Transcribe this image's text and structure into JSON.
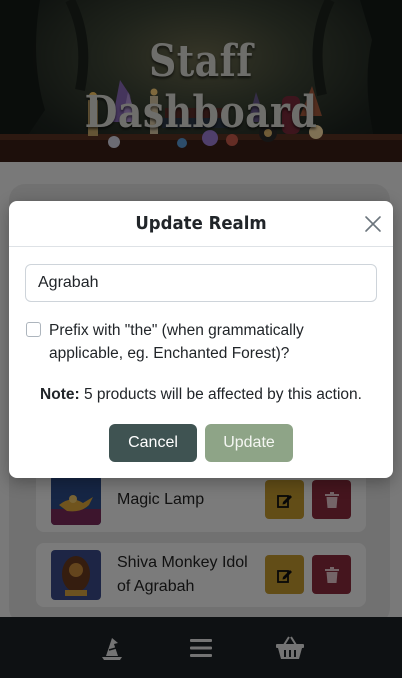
{
  "header": {
    "title": "Staff Dashboard"
  },
  "products": [
    {
      "name": "Magic Lamp",
      "thumb_icon": "magic-lamp-image"
    },
    {
      "name": "Shiva Monkey Idol of Agrabah",
      "thumb_icon": "monkey-idol-image"
    }
  ],
  "bottom_nav": [
    {
      "icon": "wizard-hat-icon"
    },
    {
      "icon": "menu-icon"
    },
    {
      "icon": "basket-icon"
    }
  ],
  "modal": {
    "title": "Update Realm",
    "name_value": "Agrabah",
    "prefix_checked": false,
    "prefix_label": "Prefix with \"the\" (when grammatically applicable, eg. Enchanted Forest)?",
    "note_label": "Note:",
    "note_text": " 5 products will be affected by this action.",
    "cancel_label": "Cancel",
    "update_label": "Update"
  },
  "colors": {
    "cancel_button": "#3f5352",
    "update_button": "#8ea487",
    "edit_button": "#c49a2e",
    "delete_button": "#8b2a3c",
    "bottom_nav": "#1c2326"
  }
}
